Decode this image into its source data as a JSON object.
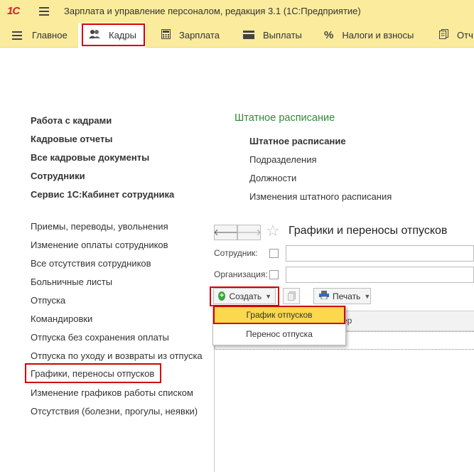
{
  "titlebar": {
    "logo": "1С",
    "title": "Зарплата и управление персоналом, редакция 3.1  (1С:Предприятие)"
  },
  "sections": [
    {
      "label": "Главное"
    },
    {
      "label": "Кадры"
    },
    {
      "label": "Зарплата"
    },
    {
      "label": "Выплаты"
    },
    {
      "label": "Налоги и взносы"
    },
    {
      "label": "Отч"
    }
  ],
  "left_panel": {
    "bold_links": [
      "Работа с кадрами",
      "Кадровые отчеты",
      "Все кадровые документы",
      "Сотрудники",
      "Сервис 1С:Кабинет сотрудника"
    ],
    "links": [
      "Приемы, переводы, увольнения",
      "Изменение оплаты сотрудников",
      "Все отсутствия сотрудников",
      "Больничные листы",
      "Отпуска",
      "Командировки",
      "Отпуска без сохранения оплаты",
      "Отпуска по уходу и возвраты из отпуска",
      "Графики, переносы отпусков",
      "Изменение графиков работы списком",
      "Отсутствия (болезни, прогулы, неявки)"
    ]
  },
  "staffing": {
    "title": "Штатное расписание",
    "items": [
      "Штатное расписание",
      "Подразделения",
      "Должности",
      "Изменения штатного расписания"
    ]
  },
  "form": {
    "back_glyph": "🡐",
    "forward_glyph": "🡒",
    "title": "Графики и переносы отпусков",
    "employee_label": "Сотрудник:",
    "organization_label": "Организация:",
    "create_label": "Создать",
    "print_label": "Печать",
    "column_partial": "ер"
  },
  "dropdown": {
    "items": [
      "График отпусков",
      "Перенос отпуска"
    ]
  },
  "colors": {
    "accent_yellow": "#fbeb9c",
    "highlight_red": "#d40000",
    "green_title": "#2d8a3a",
    "selected_item": "#fbd84c"
  }
}
